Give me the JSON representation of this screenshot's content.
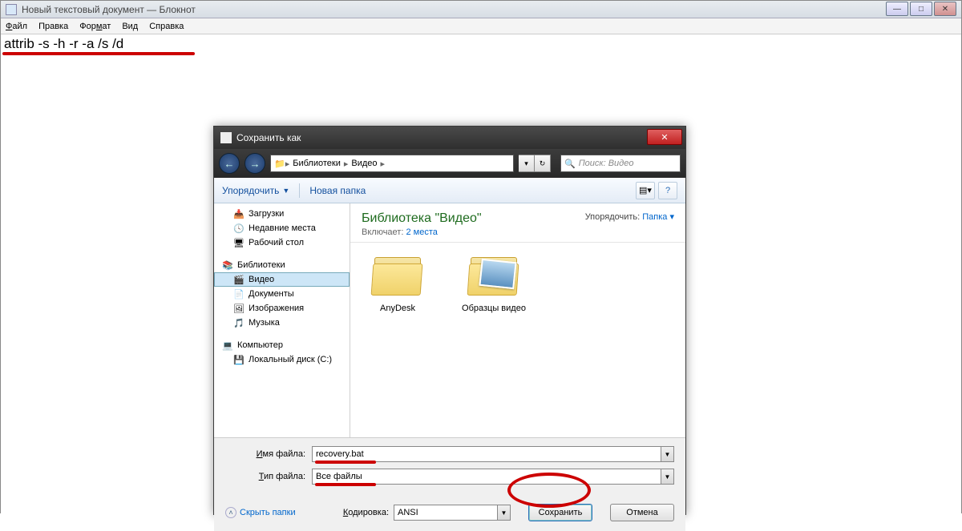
{
  "notepad": {
    "title": "Новый текстовый документ — Блокнот",
    "menu": {
      "file": "Файл",
      "edit": "Правка",
      "format": "Формат",
      "view": "Вид",
      "help": "Справка"
    },
    "content": "attrib -s -h -r -a /s /d"
  },
  "dialog": {
    "title": "Сохранить как",
    "nav": {
      "back": "←",
      "fwd": "→",
      "path_root_icon": "📁",
      "seg1": "Библиотеки",
      "seg2": "Видео",
      "refresh": "↻",
      "search_placeholder": "Поиск: Видео"
    },
    "toolbar": {
      "organize": "Упорядочить",
      "new_folder": "Новая папка"
    },
    "sidebar": {
      "downloads": "Загрузки",
      "recent": "Недавние места",
      "desktop": "Рабочий стол",
      "libraries": "Библиотеки",
      "video": "Видео",
      "documents": "Документы",
      "pictures": "Изображения",
      "music": "Музыка",
      "computer": "Компьютер",
      "disk_c": "Локальный диск (C:)"
    },
    "content": {
      "title": "Библиотека \"Видео\"",
      "includes_label": "Включает:",
      "includes_link": "2 места",
      "arrange_label": "Упорядочить:",
      "arrange_value": "Папка",
      "items": [
        "AnyDesk",
        "Образцы видео"
      ]
    },
    "fields": {
      "name_label": "Имя файла:",
      "name_value": "recovery.bat",
      "type_label": "Тип файла:",
      "type_value": "Все файлы"
    },
    "footer": {
      "hide": "Скрыть папки",
      "encoding_label": "Кодировка:",
      "encoding_value": "ANSI",
      "save": "Сохранить",
      "cancel": "Отмена"
    }
  }
}
